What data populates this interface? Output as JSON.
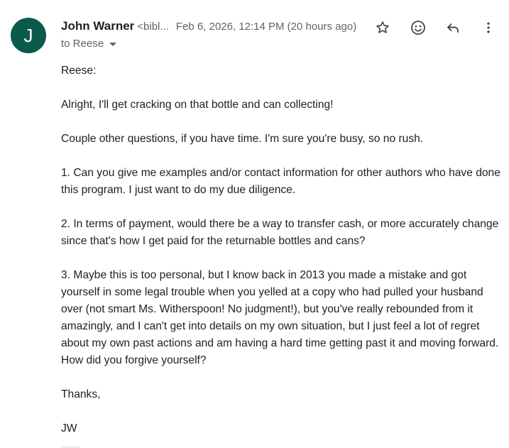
{
  "sender": {
    "avatar_initial": "J",
    "avatar_color": "#0b5a4a",
    "name": "John Warner",
    "email_truncated": "<bibl...",
    "date": "Feb 6, 2026, 12:14 PM (20 hours ago)",
    "to": "to Reese"
  },
  "actions": [
    {
      "icon": "star-icon"
    },
    {
      "icon": "emoji-icon"
    },
    {
      "icon": "reply-icon"
    },
    {
      "icon": "more-vert-icon"
    }
  ],
  "body": {
    "greeting": "Reese:",
    "paragraphs": [
      "Alright, I'll get cracking on that bottle and can collecting!",
      "Couple other questions, if you have time. I'm sure you're busy, so no rush.",
      "1. Can you give me examples and/or contact information for other authors who have done this program. I just want to do my due diligence.",
      "2. In terms of payment, would there be a way to transfer cash, or more accurately change since that's how I get paid for the returnable bottles and cans?",
      "3. Maybe this is too personal, but I know back in 2013 you made a mistake and got yourself in some legal trouble when you yelled at a copy who had pulled your husband over (not smart Ms. Witherspoon! No judgment!), but you've really rebounded from it amazingly, and I can't get into details on my own situation, but I just feel a lot of regret about my own past actions and am having a hard time getting past it and moving forward. How did you forgive yourself?"
    ],
    "closing": "Thanks,",
    "signature": "JW"
  }
}
